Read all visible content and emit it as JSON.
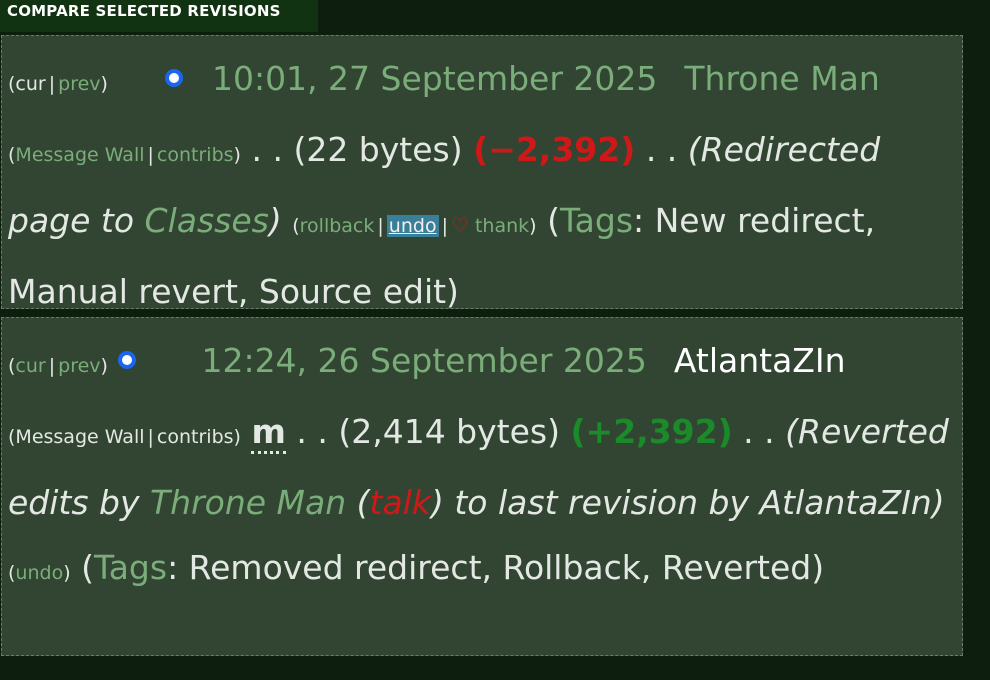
{
  "compare_button": "COMPARE SELECTED REVISIONS",
  "revisions": [
    {
      "cur": "cur",
      "prev": "prev",
      "open_paren": "(",
      "close_paren": ")",
      "timestamp": "10:01, 27 September 2025",
      "user": "Throne Man",
      "message_wall": "Message Wall",
      "contribs": "contribs",
      "dots1": ". .",
      "size": "(22 bytes)",
      "diff": "(−2,392)",
      "dots2": ". .",
      "summary_open": "(Redirected page to ",
      "summary_link": "Classes",
      "summary_close": ")",
      "actions": [
        "rollback",
        "undo",
        "thank"
      ],
      "tags_label": "Tags",
      "tags_text": ": New redirect, Manual revert, Source edit)"
    },
    {
      "cur": "cur",
      "prev": "prev",
      "open_paren": "(",
      "close_paren": ")",
      "timestamp": "12:24, 26 September 2025",
      "user": "AtlantaZIn",
      "message_wall": "Message Wall",
      "contribs": "contribs",
      "minor": "m",
      "dots1": ". .",
      "size": "(2,414 bytes)",
      "diff": "(+2,392)",
      "dots2": ". .",
      "summary_open": "(Reverted edits by ",
      "summary_user": "Throne Man",
      "summary_talk_open": " (",
      "summary_talk": "talk",
      "summary_talk_close": ") to last revision by AtlantaZIn)",
      "actions": [
        "undo"
      ],
      "tags_label": "Tags",
      "tags_text": ": Removed redirect, Rollback, Reverted)"
    }
  ]
}
